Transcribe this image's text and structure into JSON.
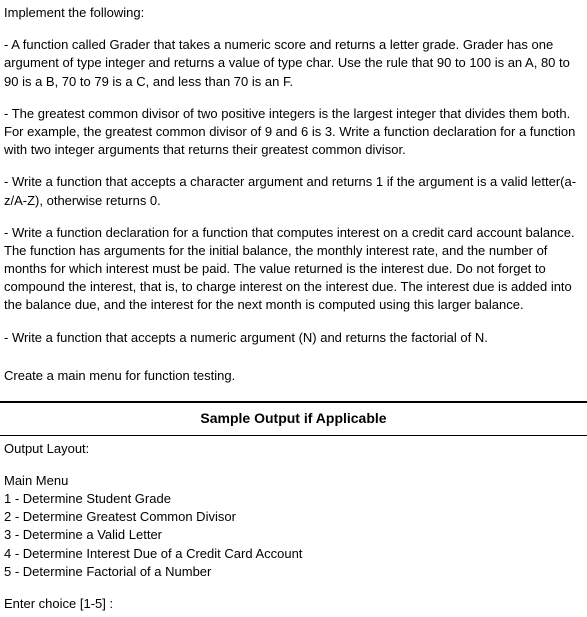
{
  "top": {
    "intro": "Implement the following:",
    "p1": "- A function called Grader that takes a numeric score and returns a letter grade. Grader has one argument of type integer and returns a value of type char. Use the rule that 90 to 100 is an A, 80 to 90 is a B, 70 to 79 is a C, and less than 70 is an F.",
    "p2": "- The greatest common divisor of two positive integers is the largest integer that divides them both.  For example, the greatest common divisor of 9 and 6 is 3. Write a function declaration for a function with two integer arguments that returns their greatest common divisor.",
    "p3": "- Write a function that accepts a character argument and returns 1 if the argument is a valid letter(a-z/A-Z), otherwise returns 0.",
    "p4": "- Write a function declaration for a function that computes interest on a credit card account balance. The function has arguments for the initial balance, the monthly interest rate, and the number of months for which interest must be paid. The value returned is the interest due. Do not forget to compound the interest, that is, to charge interest on the interest due. The interest due is added into the balance due, and the interest for the next month is computed using this larger balance.",
    "p5": "- Write a function that accepts a numeric argument (N) and returns the factorial of N.",
    "create": "Create a main menu for function testing."
  },
  "header": "Sample Output if Applicable",
  "bottom": {
    "outputLabel": "Output Layout:",
    "menuTitle": "Main Menu",
    "items": [
      "1 -  Determine Student Grade",
      "2 -  Determine Greatest Common Divisor",
      "3 -  Determine a Valid Letter",
      "4 -  Determine Interest Due of a Credit Card Account",
      "5 -  Determine Factorial of a Number"
    ],
    "prompt": "Enter choice [1-5] :"
  }
}
